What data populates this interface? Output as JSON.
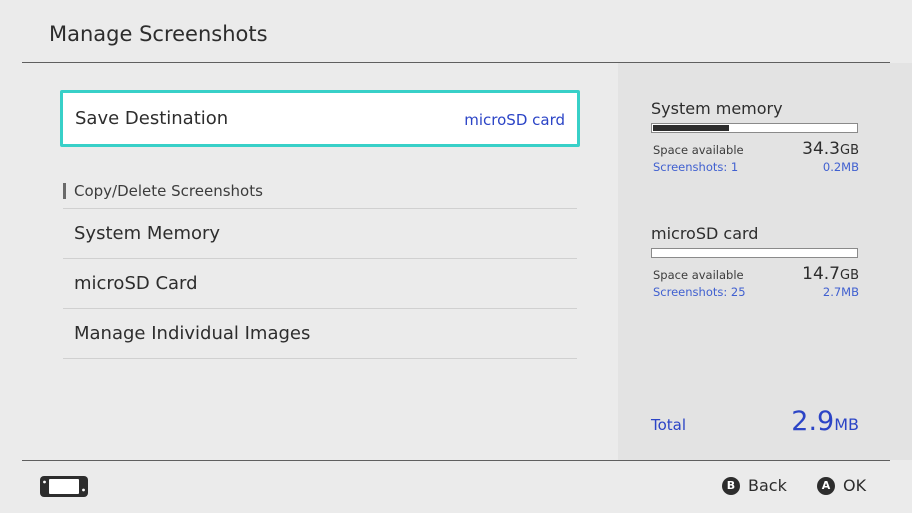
{
  "header": {
    "title": "Manage Screenshots"
  },
  "save_destination": {
    "label": "Save Destination",
    "value": "microSD card"
  },
  "copy_section": {
    "title": "Copy/Delete Screenshots",
    "items": [
      {
        "label": "System Memory"
      },
      {
        "label": "microSD Card"
      },
      {
        "label": "Manage Individual Images"
      }
    ]
  },
  "storage": [
    {
      "title": "System memory",
      "fill_fraction": 0.38,
      "space_label": "Space available",
      "space_value": "34.3",
      "space_unit": "GB",
      "screenshots_label": "Screenshots: 1",
      "screenshots_size": "0.2MB"
    },
    {
      "title": "microSD card",
      "fill_fraction": 0.0,
      "space_label": "Space available",
      "space_value": "14.7",
      "space_unit": "GB",
      "screenshots_label": "Screenshots: 25",
      "screenshots_size": "2.7MB"
    }
  ],
  "total": {
    "label": "Total",
    "value": "2.9",
    "unit": "MB"
  },
  "footer": {
    "back": {
      "glyph": "B",
      "label": "Back"
    },
    "ok": {
      "glyph": "A",
      "label": "OK"
    },
    "console_icon": "handheld-console-icon"
  },
  "colors": {
    "accent_cyan": "#38d0c8",
    "link_blue": "#2b44c6",
    "background": "#ebebeb",
    "panel": "#e3e3e3"
  }
}
